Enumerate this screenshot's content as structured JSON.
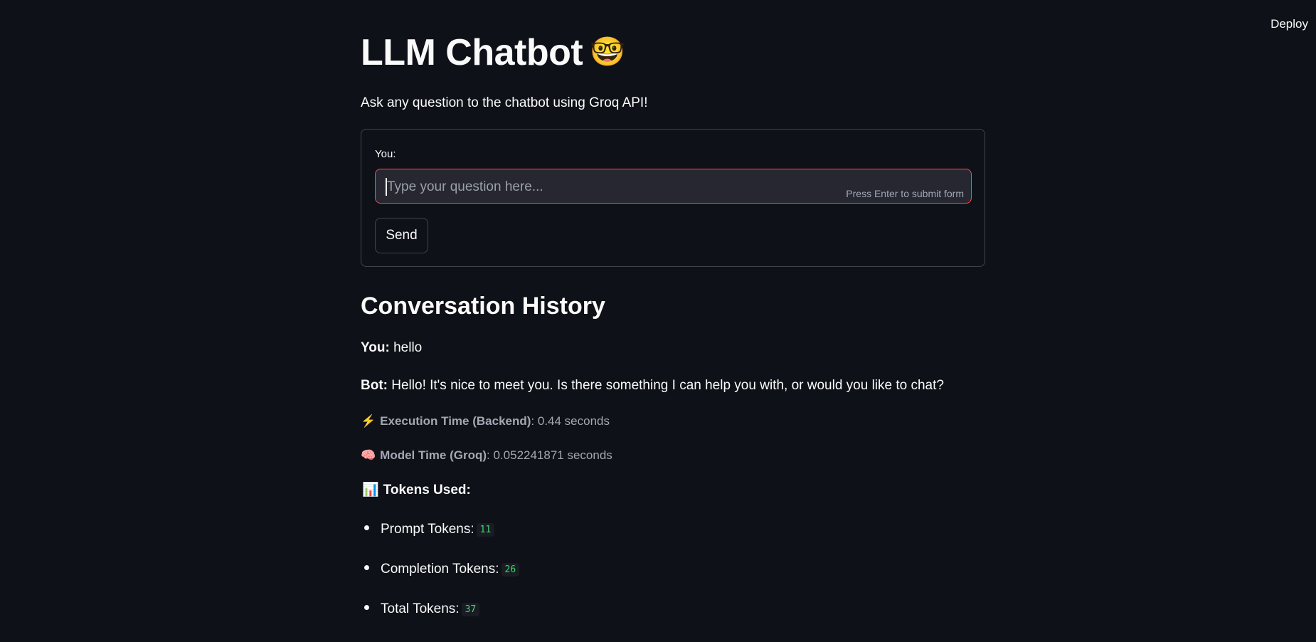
{
  "header": {
    "deploy_label": "Deploy"
  },
  "page": {
    "title": "LLM Chatbot",
    "title_emoji": "🤓",
    "subtitle": "Ask any question to the chatbot using Groq API!"
  },
  "form": {
    "label": "You:",
    "input_value": "",
    "input_placeholder": "Type your question here...",
    "hint": "Press Enter to submit form",
    "submit_label": "Send"
  },
  "history": {
    "title": "Conversation History",
    "user_label": "You:",
    "user_message": "hello",
    "bot_label": "Bot:",
    "bot_message": "Hello! It's nice to meet you. Is there something I can help you with, or would you like to chat?",
    "execution": {
      "icon": "⚡",
      "label": "Execution Time (Backend)",
      "value": ": 0.44 seconds"
    },
    "model": {
      "icon": "🧠",
      "label": "Model Time (Groq)",
      "value": ": 0.052241871 seconds"
    },
    "tokens": {
      "icon": "📊",
      "heading": "Tokens Used:",
      "items": [
        {
          "label": "Prompt Tokens:",
          "value": "11"
        },
        {
          "label": "Completion Tokens:",
          "value": "26"
        },
        {
          "label": "Total Tokens:",
          "value": "37"
        }
      ]
    }
  }
}
